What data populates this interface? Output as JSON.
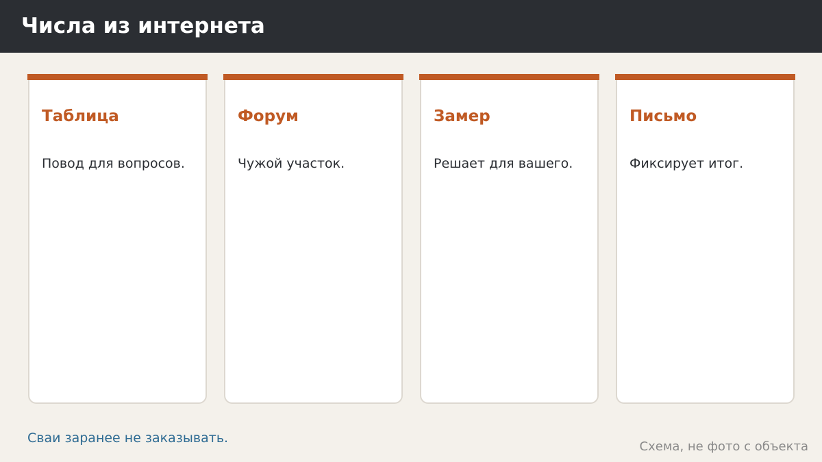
{
  "header": {
    "title": "Числа из интернета"
  },
  "cards": [
    {
      "title": "Таблица",
      "text": "Повод для вопросов."
    },
    {
      "title": "Форум",
      "text": "Чужой участок."
    },
    {
      "title": "Замер",
      "text": "Решает для вашего."
    },
    {
      "title": "Письмо",
      "text": "Фиксирует итог."
    }
  ],
  "footer": {
    "note": "Сваи заранее не заказывать.",
    "caption": "Схема, не фото с объекта"
  },
  "colors": {
    "accent": "#c05a24",
    "header_bg": "#2b2e33",
    "page_bg": "#f4f1eb",
    "note": "#2e6b93",
    "caption": "#8a8a8a"
  }
}
